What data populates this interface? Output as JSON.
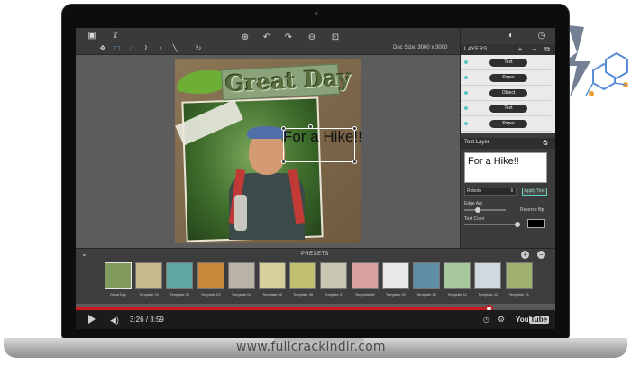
{
  "watermark": "www.fullcrackindir.com",
  "toolbar": {
    "doc_size_label": "Doc Size: 3000 x 3000"
  },
  "canvas": {
    "title_text": "Great Day",
    "overlay_text": "For a Hike!!"
  },
  "layers_panel": {
    "title": "LAYERS",
    "items": [
      {
        "label": "Text"
      },
      {
        "label": "Paper"
      },
      {
        "label": "Object"
      },
      {
        "label": "Text"
      },
      {
        "label": "Paper"
      }
    ]
  },
  "text_layer": {
    "title": "Text Layer",
    "text_value": "For a Hike!!",
    "font": "Roboto",
    "apply_label": "Apply Text",
    "edge_arc_label": "Edge Arc",
    "reverse_flip_label": "Reverse flip",
    "text_color_label": "Text Color",
    "text_color": "#000000"
  },
  "presets": {
    "title": "PRESETS",
    "items": [
      {
        "label": "Great Day",
        "color": "#7f9a5a"
      },
      {
        "label": "Template 01",
        "color": "#c9b98e"
      },
      {
        "label": "Template 02",
        "color": "#5fa7a5"
      },
      {
        "label": "Template 03",
        "color": "#c88a3a"
      },
      {
        "label": "Template 04",
        "color": "#b9b3a6"
      },
      {
        "label": "Template 05",
        "color": "#d7cf9c"
      },
      {
        "label": "Template 06",
        "color": "#c2c070"
      },
      {
        "label": "Template 07",
        "color": "#c9c7b4"
      },
      {
        "label": "Template 08",
        "color": "#d8a0a0"
      },
      {
        "label": "Template 09",
        "color": "#e8e8e8"
      },
      {
        "label": "Template 10",
        "color": "#5f8fa8"
      },
      {
        "label": "Template 11",
        "color": "#a8c8a0"
      },
      {
        "label": "Template 12",
        "color": "#d0d8e0"
      },
      {
        "label": "Template 13",
        "color": "#9fb070"
      }
    ]
  },
  "video": {
    "time_current": "3:26",
    "time_total": "3:59",
    "time_separator": "/",
    "progress_fraction": 0.86,
    "brand": "You",
    "brand_tube": "Tube"
  },
  "colors": {
    "accent": "#cc181e",
    "teal": "#5cc6c6",
    "logo_blue": "#5a8fd8",
    "logo_orange": "#f0a030"
  }
}
